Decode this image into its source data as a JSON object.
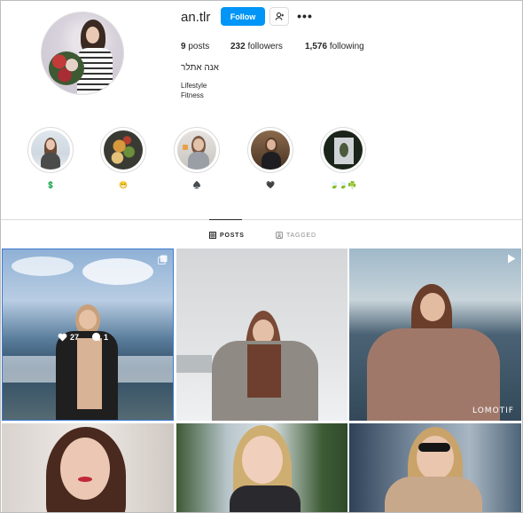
{
  "profile": {
    "username": "an.tlr",
    "follow_label": "Follow",
    "more_label": "•••",
    "posts_count": "9",
    "posts_label": "posts",
    "followers_count": "232",
    "followers_label": "followers",
    "following_count": "1,576",
    "following_label": "following",
    "full_name": "אנה אתלר",
    "bio_line1": "Lifestyle",
    "bio_line2": "Fitness"
  },
  "highlights": [
    {
      "label": "💲"
    },
    {
      "label": "😁"
    },
    {
      "label": "♠️"
    },
    {
      "label": "🖤"
    },
    {
      "label": "🍃🍃☘️"
    }
  ],
  "tabs": {
    "posts": "POSTS",
    "tagged": "TAGGED"
  },
  "posts": [
    {
      "likes": "27",
      "comments": "1"
    },
    {},
    {
      "watermark": "LOMOTIF"
    },
    {},
    {},
    {}
  ],
  "colors": {
    "accent": "#0095f6",
    "text": "#262626",
    "muted": "#8e8e8e",
    "border": "#dbdbdb"
  }
}
